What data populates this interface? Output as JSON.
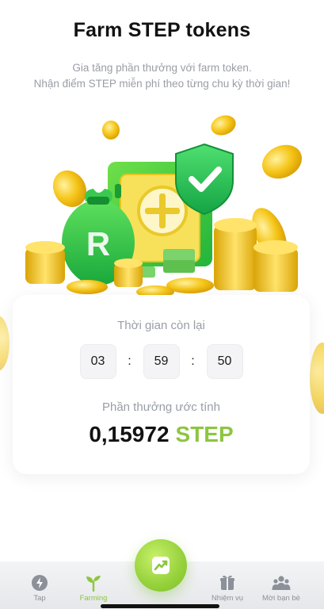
{
  "header": {
    "title": "Farm STEP tokens",
    "subtitle_line1": "Gia tăng phần thưởng với farm token.",
    "subtitle_line2": "Nhận điểm STEP miễn phí theo từng chu kỳ thời gian!"
  },
  "hero": {
    "logo_letter": "R",
    "icons": [
      "money-bag-icon",
      "safe-icon",
      "shield-check-icon",
      "coin-icon"
    ]
  },
  "card": {
    "time_left_label": "Thời gian còn lại",
    "timer": {
      "hours": "03",
      "minutes": "59",
      "seconds": "50",
      "separator": ":"
    },
    "reward_label": "Phần thưởng ước tính",
    "reward_value": "0,15972",
    "reward_unit": "STEP"
  },
  "tabbar": {
    "tabs": [
      {
        "label": "Tap",
        "icon": "lightning-icon"
      },
      {
        "label": "Farming",
        "icon": "sprout-icon",
        "active": true
      },
      {
        "label": "Nhiệm vụ",
        "icon": "gift-icon"
      },
      {
        "label": "Mời bạn bè",
        "icon": "friends-icon"
      }
    ],
    "fab_icon": "chart-up-icon"
  },
  "colors": {
    "accent": "#8cc63f",
    "coin": "#f1c40f",
    "text_muted": "#9a9da6"
  }
}
